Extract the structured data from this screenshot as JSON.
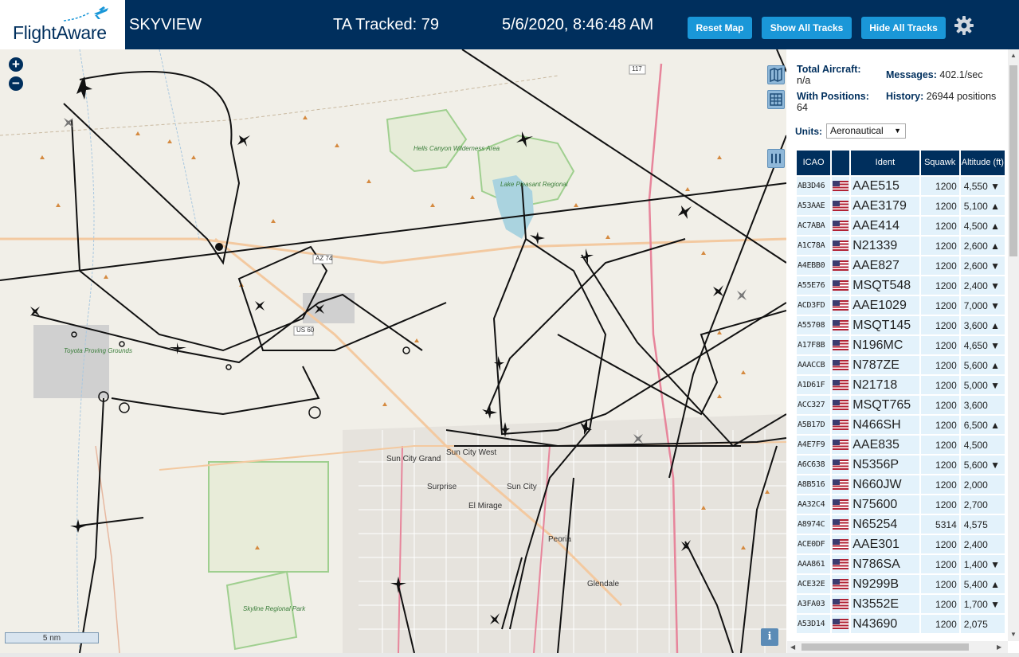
{
  "header": {
    "logo_text": "FlightAware",
    "app_title": "SKYVIEW",
    "tracked": "TA Tracked: 79",
    "datetime": "5/6/2020, 8:46:48 AM",
    "buttons": [
      "Reset Map",
      "Show All Tracks",
      "Hide All Tracks"
    ],
    "accent_color": "#1a97d8",
    "bar_color": "#002f5d"
  },
  "map": {
    "zoom_in": "+",
    "zoom_out": "−",
    "scale": "5 nm",
    "info": "i",
    "labels": {
      "hells_canyon": "Hells Canyon Wilderness Area",
      "lake_pleasant": "Lake Pleasant Regional",
      "toyota": "Toyota Proving Grounds",
      "skyline": "Skyline Regional Park",
      "sun_city_grand": "Sun City Grand",
      "sun_city_west": "Sun City West",
      "surprise": "Surprise",
      "sun_city": "Sun City",
      "el_mirage": "El Mirage",
      "peoria": "Peoria",
      "glendale": "Glendale",
      "az74": "AZ 74",
      "us60": "US 60",
      "i17": "117"
    }
  },
  "panel": {
    "total_aircraft_label": "Total Aircraft:",
    "total_aircraft_value": "n/a",
    "with_positions_label": "With Positions:",
    "with_positions_value": "64",
    "messages_label": "Messages:",
    "messages_value": "402.1/sec",
    "history_label": "History:",
    "history_value": "26944 positions",
    "units_label": "Units:",
    "units_value": "Aeronautical",
    "columns": [
      "ICAO",
      "",
      "Ident",
      "Squawk",
      "Altitude (ft)"
    ],
    "rows": [
      {
        "icao": "AB3D46",
        "ident": "AAE515",
        "squawk": "1200",
        "alt": "4,550 ▼"
      },
      {
        "icao": "A53AAE",
        "ident": "AAE3179",
        "squawk": "1200",
        "alt": "5,100 ▲"
      },
      {
        "icao": "AC7ABA",
        "ident": "AAE414",
        "squawk": "1200",
        "alt": "4,500 ▲"
      },
      {
        "icao": "A1C78A",
        "ident": "N21339",
        "squawk": "1200",
        "alt": "2,600 ▲"
      },
      {
        "icao": "A4EBB0",
        "ident": "AAE827",
        "squawk": "1200",
        "alt": "2,600 ▼"
      },
      {
        "icao": "A55E76",
        "ident": "MSQT548",
        "squawk": "1200",
        "alt": "2,400 ▼"
      },
      {
        "icao": "ACD3FD",
        "ident": "AAE1029",
        "squawk": "1200",
        "alt": "7,000 ▼"
      },
      {
        "icao": "A55708",
        "ident": "MSQT145",
        "squawk": "1200",
        "alt": "3,600 ▲"
      },
      {
        "icao": "A17F8B",
        "ident": "N196MC",
        "squawk": "1200",
        "alt": "4,650 ▼"
      },
      {
        "icao": "AAACCB",
        "ident": "N787ZE",
        "squawk": "1200",
        "alt": "5,600 ▲"
      },
      {
        "icao": "A1D61F",
        "ident": "N21718",
        "squawk": "1200",
        "alt": "5,000 ▼"
      },
      {
        "icao": "ACC327",
        "ident": "MSQT765",
        "squawk": "1200",
        "alt": "3,600"
      },
      {
        "icao": "A5B17D",
        "ident": "N466SH",
        "squawk": "1200",
        "alt": "6,500 ▲"
      },
      {
        "icao": "A4E7F9",
        "ident": "AAE835",
        "squawk": "1200",
        "alt": "4,500"
      },
      {
        "icao": "A6C638",
        "ident": "N5356P",
        "squawk": "1200",
        "alt": "5,600 ▼"
      },
      {
        "icao": "A8B516",
        "ident": "N660JW",
        "squawk": "1200",
        "alt": "2,000"
      },
      {
        "icao": "AA32C4",
        "ident": "N75600",
        "squawk": "1200",
        "alt": "2,700"
      },
      {
        "icao": "A8974C",
        "ident": "N65254",
        "squawk": "5314",
        "alt": "4,575"
      },
      {
        "icao": "ACE0DF",
        "ident": "AAE301",
        "squawk": "1200",
        "alt": "2,400"
      },
      {
        "icao": "AAA861",
        "ident": "N786SA",
        "squawk": "1200",
        "alt": "1,400 ▼"
      },
      {
        "icao": "ACE32E",
        "ident": "N9299B",
        "squawk": "1200",
        "alt": "5,400 ▲"
      },
      {
        "icao": "A3FA03",
        "ident": "N3552E",
        "squawk": "1200",
        "alt": "1,700 ▼"
      },
      {
        "icao": "A53D14",
        "ident": "N43690",
        "squawk": "1200",
        "alt": "2,075"
      }
    ]
  }
}
